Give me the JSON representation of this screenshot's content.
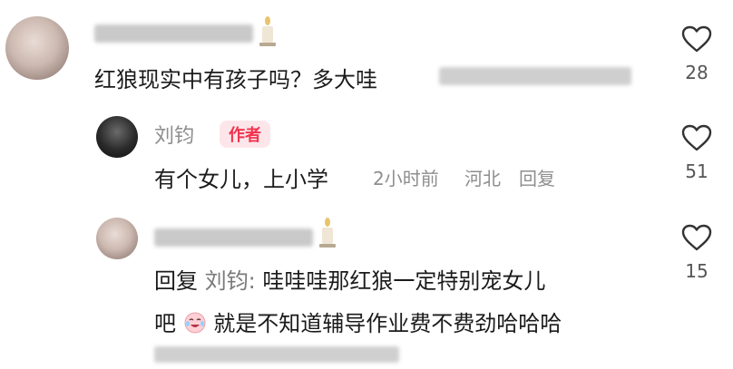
{
  "comments": [
    {
      "text": "红狼现实中有孩子吗？多大哇",
      "likes": "28"
    },
    {
      "author": "刘钧",
      "badge": "作者",
      "text": "有个女儿，上小学",
      "time": "2小时前",
      "location": "河北",
      "reply_label": "回复",
      "likes": "51"
    },
    {
      "reply_prefix": "回复",
      "reply_to": "刘钧:",
      "text_line1": "哇哇哇那红狼一定特别宠女儿",
      "text_line2_start": "吧",
      "text_line2_end": "就是不知道辅导作业费不费劲哈哈哈",
      "likes": "15"
    }
  ],
  "icons": {
    "like": "heart-outline-icon",
    "emoji": "crying-laughing-emoji-icon",
    "candle": "candle-icon"
  },
  "colors": {
    "author_badge_bg": "#fde6ea",
    "author_badge_text": "#f0334f",
    "meta_gray": "#8e8e8e"
  }
}
